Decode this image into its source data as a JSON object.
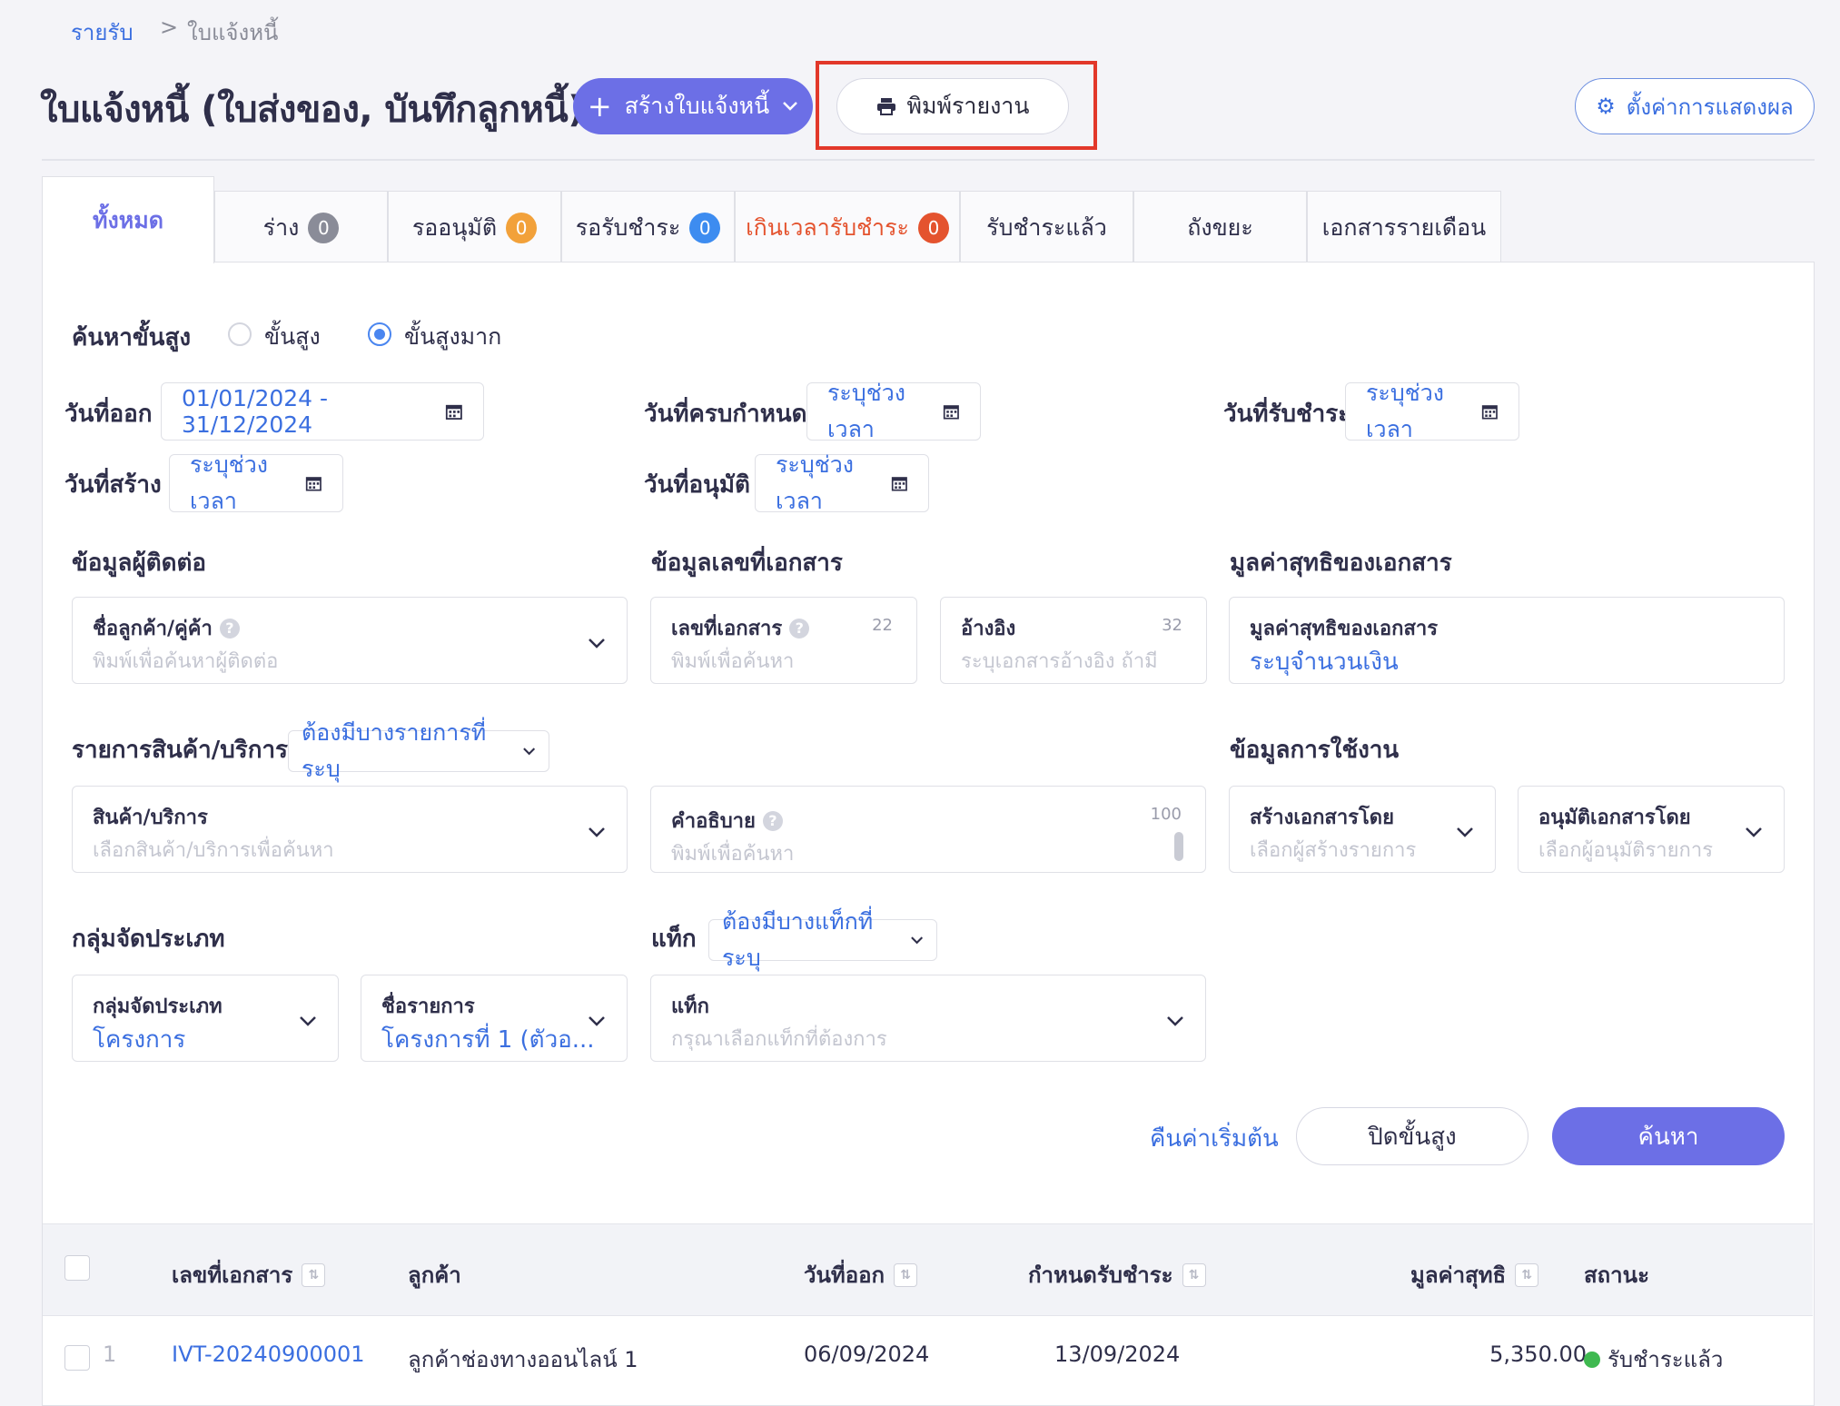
{
  "breadcrumb": {
    "root": "รายรับ",
    "separator": ">",
    "current": "ใบแจ้งหนี้"
  },
  "header": {
    "title": "ใบแจ้งหนี้ (ใบส่งของ, บันทึกลูกหนี้)",
    "create_label": "สร้างใบแจ้งหนี้",
    "print_label": "พิมพ์รายงาน",
    "settings_label": "ตั้งค่าการแสดงผล"
  },
  "tabs": [
    {
      "label": "ทั้งหมด"
    },
    {
      "label": "ร่าง",
      "count": "0",
      "badge_color": "#8a8c98"
    },
    {
      "label": "รออนุมัติ",
      "count": "0",
      "badge_color": "#f2a13a"
    },
    {
      "label": "รอรับชำระ",
      "count": "0",
      "badge_color": "#3d8cf0"
    },
    {
      "label": "เกินเวลารับชำระ",
      "count": "0",
      "badge_color": "#e4532e"
    },
    {
      "label": "รับชำระแล้ว"
    },
    {
      "label": "ถังขยะ"
    },
    {
      "label": "เอกสารรายเดือน"
    }
  ],
  "search": {
    "title": "ค้นหาขั้นสูง",
    "mode_advanced": "ขั้นสูง",
    "mode_very_advanced": "ขั้นสูงมาก",
    "issue_date_label": "วันที่ออก",
    "issue_date_value": "01/01/2024 - 31/12/2024",
    "due_date_label": "วันที่ครบกำหนด",
    "due_date_value": "ระบุช่วงเวลา",
    "paid_date_label": "วันที่รับชำระ",
    "paid_date_value": "ระบุช่วงเวลา",
    "created_date_label": "วันที่สร้าง",
    "created_date_value": "ระบุช่วงเวลา",
    "approved_date_label": "วันที่อนุมัติ",
    "approved_date_value": "ระบุช่วงเวลา",
    "contact_section": "ข้อมูลผู้ติดต่อ",
    "contact_field_title": "ชื่อลูกค้า/คู่ค้า",
    "contact_field_placeholder": "พิมพ์เพื่อค้นหาผู้ติดต่อ",
    "docnum_section": "ข้อมูลเลขที่เอกสาร",
    "docnum_title": "เลขที่เอกสาร",
    "docnum_count": "22",
    "docnum_placeholder": "พิมพ์เพื่อค้นหา",
    "ref_title": "อ้างอิง",
    "ref_count": "32",
    "ref_placeholder": "ระบุเอกสารอ้างอิง ถ้ามี",
    "net_section": "มูลค่าสุทธิของเอกสาร",
    "net_title": "มูลค่าสุทธิของเอกสาร",
    "net_value": "ระบุจำนวนเงิน",
    "product_section": "รายการสินค้า/บริการ",
    "product_filter": "ต้องมีบางรายการที่ระบุ",
    "product_title": "สินค้า/บริการ",
    "product_placeholder": "เลือกสินค้า/บริการเพื่อค้นหา",
    "desc_title": "คำอธิบาย",
    "desc_count": "100",
    "desc_placeholder": "พิมพ์เพื่อค้นหา",
    "usage_section": "ข้อมูลการใช้งาน",
    "creator_title": "สร้างเอกสารโดย",
    "creator_placeholder": "เลือกผู้สร้างรายการ",
    "approver_title": "อนุมัติเอกสารโดย",
    "approver_placeholder": "เลือกผู้อนุมัติรายการ",
    "group_section": "กลุ่มจัดประเภท",
    "group_title": "กลุ่มจัดประเภท",
    "group_value": "โครงการ",
    "item_title": "ชื่อรายการ",
    "item_value": "โครงการที่ 1 (ตัวอ...",
    "tag_section": "แท็ก",
    "tag_filter": "ต้องมีบางแท็กที่ระบุ",
    "tag_title": "แท็ก",
    "tag_placeholder": "กรุณาเลือกแท็กที่ต้องการ",
    "reset_label": "คืนค่าเริ่มต้น",
    "close_label": "ปิดขั้นสูง",
    "search_label": "ค้นหา"
  },
  "table": {
    "headers": {
      "docnum": "เลขที่เอกสาร",
      "customer": "ลูกค้า",
      "issue_date": "วันที่ออก",
      "due_date": "กำหนดรับชำระ",
      "net": "มูลค่าสุทธิ",
      "status": "สถานะ"
    },
    "rows": [
      {
        "index": "1",
        "docnum": "IVT-20240900001",
        "customer": "ลูกค้าช่องทางออนไลน์ 1",
        "issue_date": "06/09/2024",
        "due_date": "13/09/2024",
        "net": "5,350.00",
        "status": "รับชำระแล้ว",
        "status_color": "#3fb950"
      }
    ]
  },
  "colors": {
    "primary": "#6c6fe6",
    "link": "#3b6fe0",
    "highlight": "#e2382a",
    "overdue": "#e4532e"
  }
}
